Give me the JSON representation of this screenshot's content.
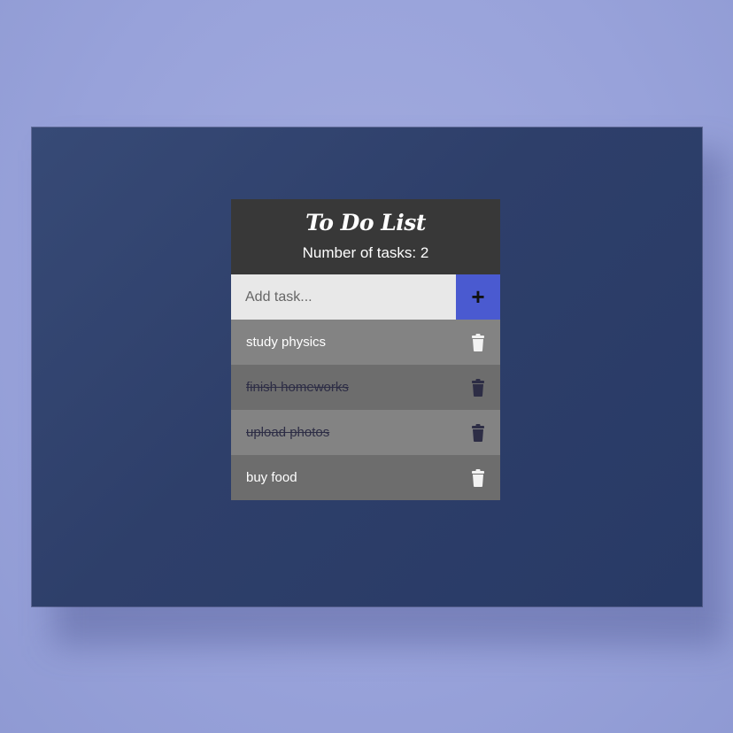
{
  "app": {
    "title": "To Do List",
    "task_count_label": "Number of tasks: 2"
  },
  "add_task": {
    "placeholder": "Add task...",
    "button_label": "+"
  },
  "tasks": [
    {
      "text": "study physics",
      "done": false,
      "icon": "trash-icon"
    },
    {
      "text": "finish homeworks",
      "done": true,
      "icon": "trash-icon"
    },
    {
      "text": "upload photos",
      "done": true,
      "icon": "trash-icon"
    },
    {
      "text": "buy food",
      "done": false,
      "icon": "trash-icon"
    }
  ],
  "colors": {
    "accent": "#4a5ad0",
    "header_bg": "#383838",
    "screen_bg": "#2e3f6a",
    "done_text": "#2d2d45"
  }
}
